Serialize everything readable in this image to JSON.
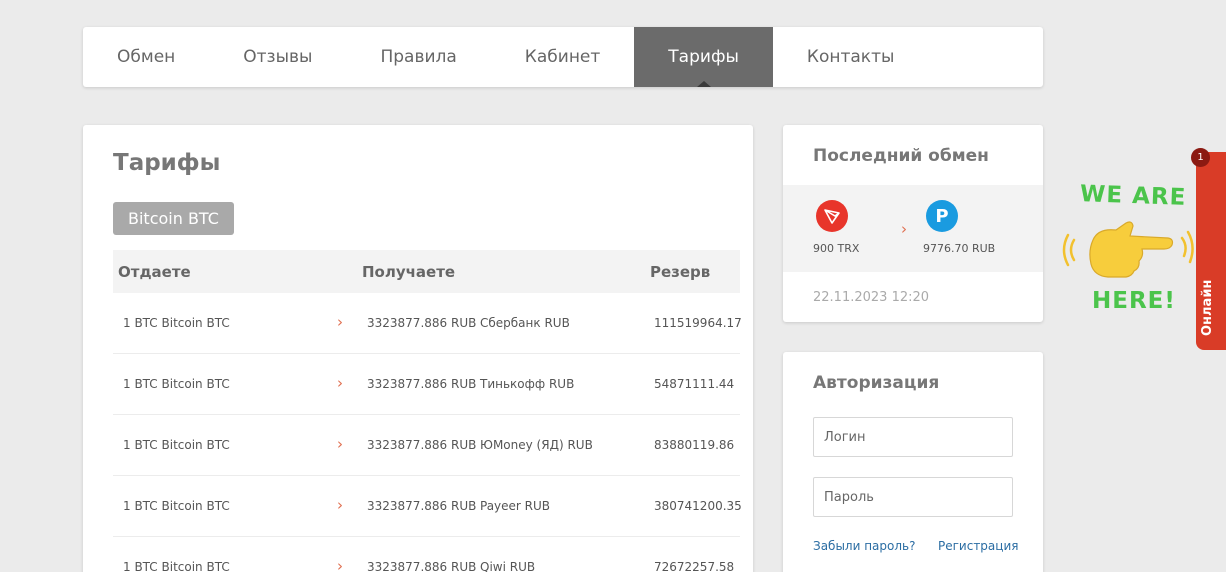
{
  "nav": {
    "items": [
      {
        "label": "Обмен"
      },
      {
        "label": "Отзывы"
      },
      {
        "label": "Правила"
      },
      {
        "label": "Кабинет"
      },
      {
        "label": "Тарифы",
        "active": true
      },
      {
        "label": "Контакты"
      }
    ]
  },
  "tariffs": {
    "title": "Тарифы",
    "currency_pill": "Bitcoin BTC",
    "columns": {
      "give": "Отдаете",
      "receive": "Получаете",
      "reserve": "Резерв"
    },
    "rows": [
      {
        "give": "1 BTC Bitcoin BTC",
        "receive_amount": "3323877.886 RUB",
        "receive_name": "Сбербанк RUB",
        "reserve": "111519964.17"
      },
      {
        "give": "1 BTC Bitcoin BTC",
        "receive_amount": "3323877.886 RUB",
        "receive_name": "Тинькофф RUB",
        "reserve": "54871111.44"
      },
      {
        "give": "1 BTC Bitcoin BTC",
        "receive_amount": "3323877.886 RUB",
        "receive_name": "ЮMoney (ЯД) RUB",
        "reserve": "83880119.86"
      },
      {
        "give": "1 BTC Bitcoin BTC",
        "receive_amount": "3323877.886 RUB",
        "receive_name": "Payeer RUB",
        "reserve": "380741200.35"
      },
      {
        "give": "1 BTC Bitcoin BTC",
        "receive_amount": "3323877.886 RUB",
        "receive_name": "Qiwi RUB",
        "reserve": "72672257.58"
      }
    ]
  },
  "last_exchange": {
    "title": "Последний обмен",
    "from_amount": "900 TRX",
    "to_amount": "9776.70 RUB",
    "date": "22.11.2023 12:20",
    "from_icon": "tron-icon",
    "to_icon": "payeer-icon",
    "to_icon_letter": "P"
  },
  "auth": {
    "title": "Авторизация",
    "login_placeholder": "Логин",
    "password_placeholder": "Пароль",
    "forgot_link": "Забыли пароль?",
    "register_link": "Регистрация"
  },
  "chat_widget": {
    "line1": "WE ARE",
    "line2": "HERE!",
    "tab_label": "Онлайн",
    "badge_count": "1"
  },
  "colors": {
    "accent": "#e06f50",
    "nav_active": "#6b6b6b",
    "widget_red": "#d93c27",
    "widget_green": "#4bc44b",
    "link": "#2b6da3"
  }
}
